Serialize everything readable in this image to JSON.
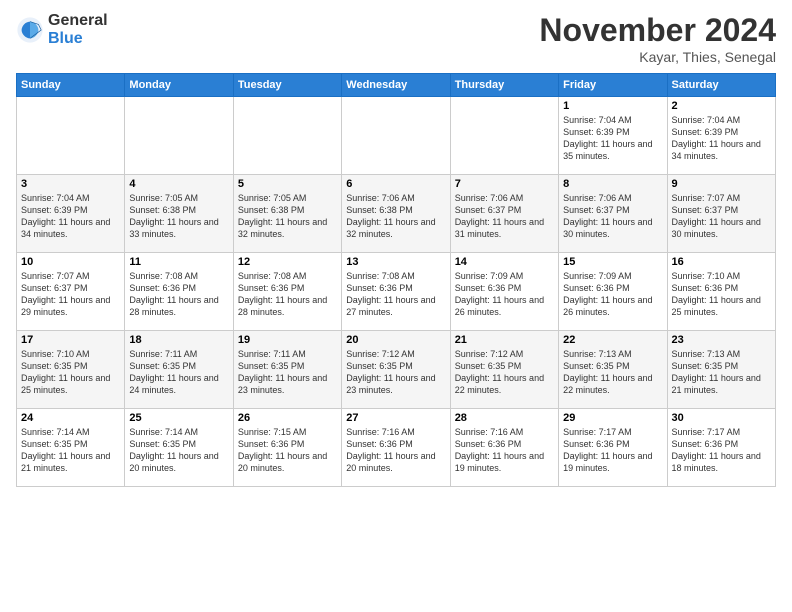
{
  "logo": {
    "general": "General",
    "blue": "Blue"
  },
  "title": "November 2024",
  "location": "Kayar, Thies, Senegal",
  "days_of_week": [
    "Sunday",
    "Monday",
    "Tuesday",
    "Wednesday",
    "Thursday",
    "Friday",
    "Saturday"
  ],
  "weeks": [
    [
      {
        "day": "",
        "detail": ""
      },
      {
        "day": "",
        "detail": ""
      },
      {
        "day": "",
        "detail": ""
      },
      {
        "day": "",
        "detail": ""
      },
      {
        "day": "",
        "detail": ""
      },
      {
        "day": "1",
        "detail": "Sunrise: 7:04 AM\nSunset: 6:39 PM\nDaylight: 11 hours\nand 35 minutes."
      },
      {
        "day": "2",
        "detail": "Sunrise: 7:04 AM\nSunset: 6:39 PM\nDaylight: 11 hours\nand 34 minutes."
      }
    ],
    [
      {
        "day": "3",
        "detail": "Sunrise: 7:04 AM\nSunset: 6:39 PM\nDaylight: 11 hours\nand 34 minutes."
      },
      {
        "day": "4",
        "detail": "Sunrise: 7:05 AM\nSunset: 6:38 PM\nDaylight: 11 hours\nand 33 minutes."
      },
      {
        "day": "5",
        "detail": "Sunrise: 7:05 AM\nSunset: 6:38 PM\nDaylight: 11 hours\nand 32 minutes."
      },
      {
        "day": "6",
        "detail": "Sunrise: 7:06 AM\nSunset: 6:38 PM\nDaylight: 11 hours\nand 32 minutes."
      },
      {
        "day": "7",
        "detail": "Sunrise: 7:06 AM\nSunset: 6:37 PM\nDaylight: 11 hours\nand 31 minutes."
      },
      {
        "day": "8",
        "detail": "Sunrise: 7:06 AM\nSunset: 6:37 PM\nDaylight: 11 hours\nand 30 minutes."
      },
      {
        "day": "9",
        "detail": "Sunrise: 7:07 AM\nSunset: 6:37 PM\nDaylight: 11 hours\nand 30 minutes."
      }
    ],
    [
      {
        "day": "10",
        "detail": "Sunrise: 7:07 AM\nSunset: 6:37 PM\nDaylight: 11 hours\nand 29 minutes."
      },
      {
        "day": "11",
        "detail": "Sunrise: 7:08 AM\nSunset: 6:36 PM\nDaylight: 11 hours\nand 28 minutes."
      },
      {
        "day": "12",
        "detail": "Sunrise: 7:08 AM\nSunset: 6:36 PM\nDaylight: 11 hours\nand 28 minutes."
      },
      {
        "day": "13",
        "detail": "Sunrise: 7:08 AM\nSunset: 6:36 PM\nDaylight: 11 hours\nand 27 minutes."
      },
      {
        "day": "14",
        "detail": "Sunrise: 7:09 AM\nSunset: 6:36 PM\nDaylight: 11 hours\nand 26 minutes."
      },
      {
        "day": "15",
        "detail": "Sunrise: 7:09 AM\nSunset: 6:36 PM\nDaylight: 11 hours\nand 26 minutes."
      },
      {
        "day": "16",
        "detail": "Sunrise: 7:10 AM\nSunset: 6:36 PM\nDaylight: 11 hours\nand 25 minutes."
      }
    ],
    [
      {
        "day": "17",
        "detail": "Sunrise: 7:10 AM\nSunset: 6:35 PM\nDaylight: 11 hours\nand 25 minutes."
      },
      {
        "day": "18",
        "detail": "Sunrise: 7:11 AM\nSunset: 6:35 PM\nDaylight: 11 hours\nand 24 minutes."
      },
      {
        "day": "19",
        "detail": "Sunrise: 7:11 AM\nSunset: 6:35 PM\nDaylight: 11 hours\nand 23 minutes."
      },
      {
        "day": "20",
        "detail": "Sunrise: 7:12 AM\nSunset: 6:35 PM\nDaylight: 11 hours\nand 23 minutes."
      },
      {
        "day": "21",
        "detail": "Sunrise: 7:12 AM\nSunset: 6:35 PM\nDaylight: 11 hours\nand 22 minutes."
      },
      {
        "day": "22",
        "detail": "Sunrise: 7:13 AM\nSunset: 6:35 PM\nDaylight: 11 hours\nand 22 minutes."
      },
      {
        "day": "23",
        "detail": "Sunrise: 7:13 AM\nSunset: 6:35 PM\nDaylight: 11 hours\nand 21 minutes."
      }
    ],
    [
      {
        "day": "24",
        "detail": "Sunrise: 7:14 AM\nSunset: 6:35 PM\nDaylight: 11 hours\nand 21 minutes."
      },
      {
        "day": "25",
        "detail": "Sunrise: 7:14 AM\nSunset: 6:35 PM\nDaylight: 11 hours\nand 20 minutes."
      },
      {
        "day": "26",
        "detail": "Sunrise: 7:15 AM\nSunset: 6:36 PM\nDaylight: 11 hours\nand 20 minutes."
      },
      {
        "day": "27",
        "detail": "Sunrise: 7:16 AM\nSunset: 6:36 PM\nDaylight: 11 hours\nand 20 minutes."
      },
      {
        "day": "28",
        "detail": "Sunrise: 7:16 AM\nSunset: 6:36 PM\nDaylight: 11 hours\nand 19 minutes."
      },
      {
        "day": "29",
        "detail": "Sunrise: 7:17 AM\nSunset: 6:36 PM\nDaylight: 11 hours\nand 19 minutes."
      },
      {
        "day": "30",
        "detail": "Sunrise: 7:17 AM\nSunset: 6:36 PM\nDaylight: 11 hours\nand 18 minutes."
      }
    ]
  ]
}
